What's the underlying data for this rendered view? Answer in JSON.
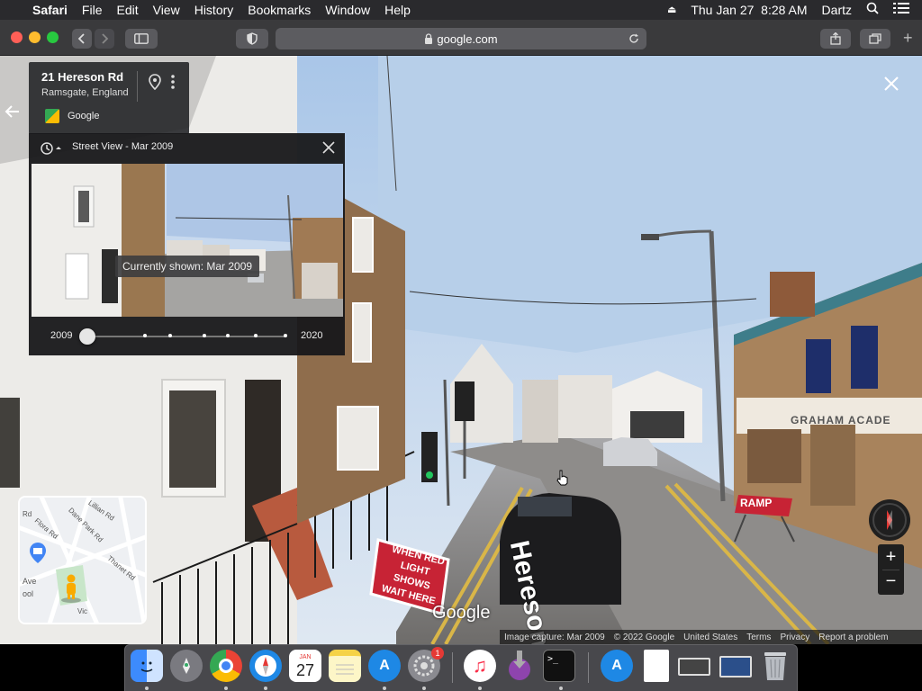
{
  "menubar": {
    "app": "Safari",
    "items": [
      "File",
      "Edit",
      "View",
      "History",
      "Bookmarks",
      "Window",
      "Help"
    ],
    "datetime": "Thu Jan 27  8:28 AM",
    "user": "Dartz"
  },
  "browser": {
    "url": "google.com"
  },
  "place": {
    "title": "21 Hereson Rd",
    "subtitle": "Ramsgate, England",
    "source": "Google"
  },
  "timemachine": {
    "header": "Street View - Mar 2009",
    "tooltip": "Currently shown: Mar 2009",
    "start_year": "2009",
    "end_year": "2020",
    "slider_position": 0
  },
  "map": {
    "labels": [
      "Lillian Rd",
      "Dane Park Rd",
      "Flora Rd",
      "Rd",
      "Thanet Rd",
      "Ave",
      "ool",
      "Vic"
    ]
  },
  "scene_text": {
    "sign": "WHEN RED LIGHT SHOWS WAIT HERE",
    "road_paint": "Hereson Rd",
    "ramp": "RAMP",
    "shop": "GRAHAM ACADE"
  },
  "logo": "Google",
  "footer": {
    "capture": "Image capture: Mar 2009",
    "copyright": "© 2022 Google",
    "country": "United States",
    "terms": "Terms",
    "privacy": "Privacy",
    "report": "Report a problem"
  },
  "controls": {
    "zoom_in": "+",
    "zoom_out": "−",
    "close": "✕"
  },
  "dock": {
    "calendar_month": "JAN",
    "calendar_day": "27",
    "badge": "1"
  }
}
